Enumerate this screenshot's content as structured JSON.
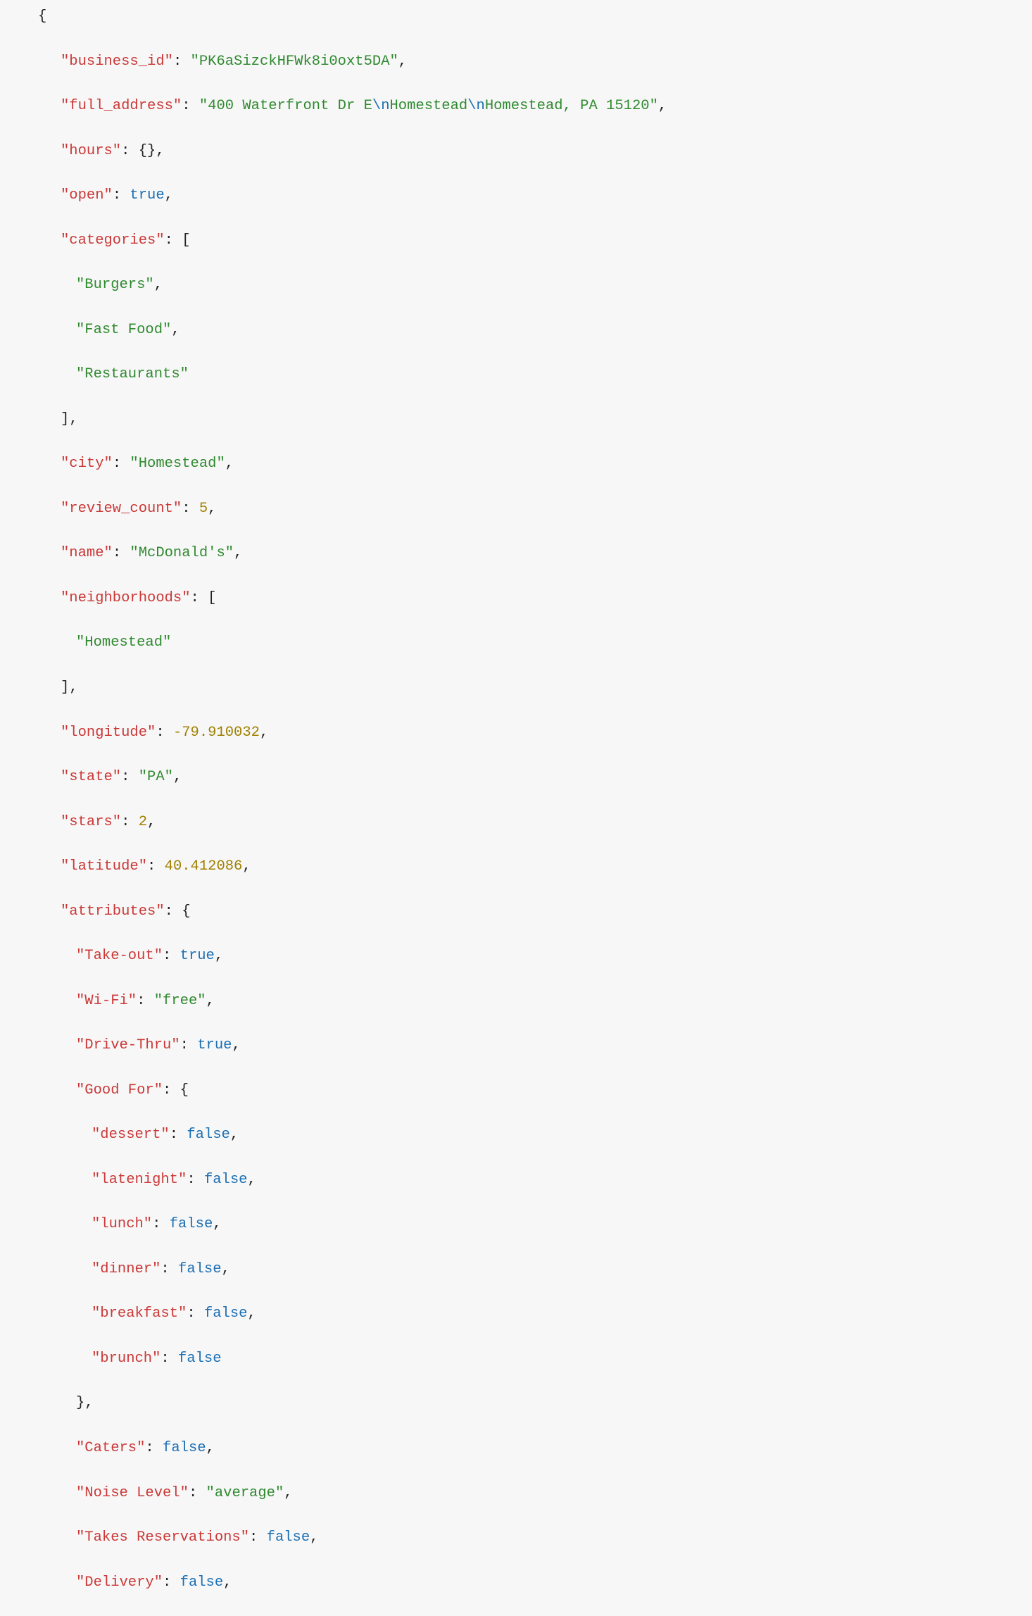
{
  "tokens": [
    {
      "parts": [
        {
          "t": "{",
          "c": "p"
        }
      ],
      "indent": 0
    },
    {
      "parts": [
        {
          "t": "\"business_id\"",
          "c": "k"
        },
        {
          "t": ": ",
          "c": "p"
        },
        {
          "t": "\"PK6aSizckHFWk8i0oxt5DA\"",
          "c": "s"
        },
        {
          "t": ",",
          "c": "p"
        }
      ],
      "indent": 1
    },
    {
      "parts": [
        {
          "t": "\"full_address\"",
          "c": "k"
        },
        {
          "t": ": ",
          "c": "p"
        },
        {
          "t": "\"400 Waterfront Dr E",
          "c": "s"
        },
        {
          "t": "\\n",
          "c": "e"
        },
        {
          "t": "Homestead",
          "c": "s"
        },
        {
          "t": "\\n",
          "c": "e"
        },
        {
          "t": "Homestead, PA 15120\"",
          "c": "s"
        },
        {
          "t": ",",
          "c": "p"
        }
      ],
      "indent": 1
    },
    {
      "parts": [
        {
          "t": "\"hours\"",
          "c": "k"
        },
        {
          "t": ": ",
          "c": "p"
        },
        {
          "t": "{}",
          "c": "p"
        },
        {
          "t": ",",
          "c": "p"
        }
      ],
      "indent": 1
    },
    {
      "parts": [
        {
          "t": "\"open\"",
          "c": "k"
        },
        {
          "t": ": ",
          "c": "p"
        },
        {
          "t": "true",
          "c": "b"
        },
        {
          "t": ",",
          "c": "p"
        }
      ],
      "indent": 1
    },
    {
      "parts": [
        {
          "t": "\"categories\"",
          "c": "k"
        },
        {
          "t": ": ",
          "c": "p"
        },
        {
          "t": "[",
          "c": "p"
        }
      ],
      "indent": 1
    },
    {
      "parts": [
        {
          "t": "\"Burgers\"",
          "c": "s"
        },
        {
          "t": ",",
          "c": "p"
        }
      ],
      "indent": 2
    },
    {
      "parts": [
        {
          "t": "\"Fast Food\"",
          "c": "s"
        },
        {
          "t": ",",
          "c": "p"
        }
      ],
      "indent": 2
    },
    {
      "parts": [
        {
          "t": "\"Restaurants\"",
          "c": "s"
        }
      ],
      "indent": 2
    },
    {
      "parts": [
        {
          "t": "]",
          "c": "p"
        },
        {
          "t": ",",
          "c": "p"
        }
      ],
      "indent": 1
    },
    {
      "parts": [
        {
          "t": "\"city\"",
          "c": "k"
        },
        {
          "t": ": ",
          "c": "p"
        },
        {
          "t": "\"Homestead\"",
          "c": "s"
        },
        {
          "t": ",",
          "c": "p"
        }
      ],
      "indent": 1
    },
    {
      "parts": [
        {
          "t": "\"review_count\"",
          "c": "k"
        },
        {
          "t": ": ",
          "c": "p"
        },
        {
          "t": "5",
          "c": "n"
        },
        {
          "t": ",",
          "c": "p"
        }
      ],
      "indent": 1
    },
    {
      "parts": [
        {
          "t": "\"name\"",
          "c": "k"
        },
        {
          "t": ": ",
          "c": "p"
        },
        {
          "t": "\"McDonald's\"",
          "c": "s"
        },
        {
          "t": ",",
          "c": "p"
        }
      ],
      "indent": 1
    },
    {
      "parts": [
        {
          "t": "\"neighborhoods\"",
          "c": "k"
        },
        {
          "t": ": ",
          "c": "p"
        },
        {
          "t": "[",
          "c": "p"
        }
      ],
      "indent": 1
    },
    {
      "parts": [
        {
          "t": "\"Homestead\"",
          "c": "s"
        }
      ],
      "indent": 2
    },
    {
      "parts": [
        {
          "t": "]",
          "c": "p"
        },
        {
          "t": ",",
          "c": "p"
        }
      ],
      "indent": 1
    },
    {
      "parts": [
        {
          "t": "\"longitude\"",
          "c": "k"
        },
        {
          "t": ": ",
          "c": "p"
        },
        {
          "t": "-79.910032",
          "c": "n"
        },
        {
          "t": ",",
          "c": "p"
        }
      ],
      "indent": 1
    },
    {
      "parts": [
        {
          "t": "\"state\"",
          "c": "k"
        },
        {
          "t": ": ",
          "c": "p"
        },
        {
          "t": "\"PA\"",
          "c": "s"
        },
        {
          "t": ",",
          "c": "p"
        }
      ],
      "indent": 1
    },
    {
      "parts": [
        {
          "t": "\"stars\"",
          "c": "k"
        },
        {
          "t": ": ",
          "c": "p"
        },
        {
          "t": "2",
          "c": "n"
        },
        {
          "t": ",",
          "c": "p"
        }
      ],
      "indent": 1
    },
    {
      "parts": [
        {
          "t": "\"latitude\"",
          "c": "k"
        },
        {
          "t": ": ",
          "c": "p"
        },
        {
          "t": "40.412086",
          "c": "n"
        },
        {
          "t": ",",
          "c": "p"
        }
      ],
      "indent": 1
    },
    {
      "parts": [
        {
          "t": "\"attributes\"",
          "c": "k"
        },
        {
          "t": ": ",
          "c": "p"
        },
        {
          "t": "{",
          "c": "p"
        }
      ],
      "indent": 1
    },
    {
      "parts": [
        {
          "t": "\"Take-out\"",
          "c": "k"
        },
        {
          "t": ": ",
          "c": "p"
        },
        {
          "t": "true",
          "c": "b"
        },
        {
          "t": ",",
          "c": "p"
        }
      ],
      "indent": 2
    },
    {
      "parts": [
        {
          "t": "\"Wi-Fi\"",
          "c": "k"
        },
        {
          "t": ": ",
          "c": "p"
        },
        {
          "t": "\"free\"",
          "c": "s"
        },
        {
          "t": ",",
          "c": "p"
        }
      ],
      "indent": 2
    },
    {
      "parts": [
        {
          "t": "\"Drive-Thru\"",
          "c": "k"
        },
        {
          "t": ": ",
          "c": "p"
        },
        {
          "t": "true",
          "c": "b"
        },
        {
          "t": ",",
          "c": "p"
        }
      ],
      "indent": 2
    },
    {
      "parts": [
        {
          "t": "\"Good For\"",
          "c": "k"
        },
        {
          "t": ": ",
          "c": "p"
        },
        {
          "t": "{",
          "c": "p"
        }
      ],
      "indent": 2
    },
    {
      "parts": [
        {
          "t": "\"dessert\"",
          "c": "k"
        },
        {
          "t": ": ",
          "c": "p"
        },
        {
          "t": "false",
          "c": "b"
        },
        {
          "t": ",",
          "c": "p"
        }
      ],
      "indent": 3
    },
    {
      "parts": [
        {
          "t": "\"latenight\"",
          "c": "k"
        },
        {
          "t": ": ",
          "c": "p"
        },
        {
          "t": "false",
          "c": "b"
        },
        {
          "t": ",",
          "c": "p"
        }
      ],
      "indent": 3
    },
    {
      "parts": [
        {
          "t": "\"lunch\"",
          "c": "k"
        },
        {
          "t": ": ",
          "c": "p"
        },
        {
          "t": "false",
          "c": "b"
        },
        {
          "t": ",",
          "c": "p"
        }
      ],
      "indent": 3
    },
    {
      "parts": [
        {
          "t": "\"dinner\"",
          "c": "k"
        },
        {
          "t": ": ",
          "c": "p"
        },
        {
          "t": "false",
          "c": "b"
        },
        {
          "t": ",",
          "c": "p"
        }
      ],
      "indent": 3
    },
    {
      "parts": [
        {
          "t": "\"breakfast\"",
          "c": "k"
        },
        {
          "t": ": ",
          "c": "p"
        },
        {
          "t": "false",
          "c": "b"
        },
        {
          "t": ",",
          "c": "p"
        }
      ],
      "indent": 3
    },
    {
      "parts": [
        {
          "t": "\"brunch\"",
          "c": "k"
        },
        {
          "t": ": ",
          "c": "p"
        },
        {
          "t": "false",
          "c": "b"
        }
      ],
      "indent": 3
    },
    {
      "parts": [
        {
          "t": "}",
          "c": "p"
        },
        {
          "t": ",",
          "c": "p"
        }
      ],
      "indent": 2
    },
    {
      "parts": [
        {
          "t": "\"Caters\"",
          "c": "k"
        },
        {
          "t": ": ",
          "c": "p"
        },
        {
          "t": "false",
          "c": "b"
        },
        {
          "t": ",",
          "c": "p"
        }
      ],
      "indent": 2
    },
    {
      "parts": [
        {
          "t": "\"Noise Level\"",
          "c": "k"
        },
        {
          "t": ": ",
          "c": "p"
        },
        {
          "t": "\"average\"",
          "c": "s"
        },
        {
          "t": ",",
          "c": "p"
        }
      ],
      "indent": 2
    },
    {
      "parts": [
        {
          "t": "\"Takes Reservations\"",
          "c": "k"
        },
        {
          "t": ": ",
          "c": "p"
        },
        {
          "t": "false",
          "c": "b"
        },
        {
          "t": ",",
          "c": "p"
        }
      ],
      "indent": 2
    },
    {
      "parts": [
        {
          "t": "\"Delivery\"",
          "c": "k"
        },
        {
          "t": ": ",
          "c": "p"
        },
        {
          "t": "false",
          "c": "b"
        },
        {
          "t": ",",
          "c": "p"
        }
      ],
      "indent": 2
    }
  ],
  "document": {
    "business_id": "PK6aSizckHFWk8i0oxt5DA",
    "full_address": "400 Waterfront Dr E\nHomestead\nHomestead, PA 15120",
    "hours": {},
    "open": true,
    "categories": [
      "Burgers",
      "Fast Food",
      "Restaurants"
    ],
    "city": "Homestead",
    "review_count": 5,
    "name": "McDonald's",
    "neighborhoods": [
      "Homestead"
    ],
    "longitude": -79.910032,
    "state": "PA",
    "stars": 2,
    "latitude": 40.412086,
    "attributes": {
      "Take-out": true,
      "Wi-Fi": "free",
      "Drive-Thru": true,
      "Good For": {
        "dessert": false,
        "latenight": false,
        "lunch": false,
        "dinner": false,
        "breakfast": false,
        "brunch": false
      },
      "Caters": false,
      "Noise Level": "average",
      "Takes Reservations": false,
      "Delivery": false
    }
  }
}
